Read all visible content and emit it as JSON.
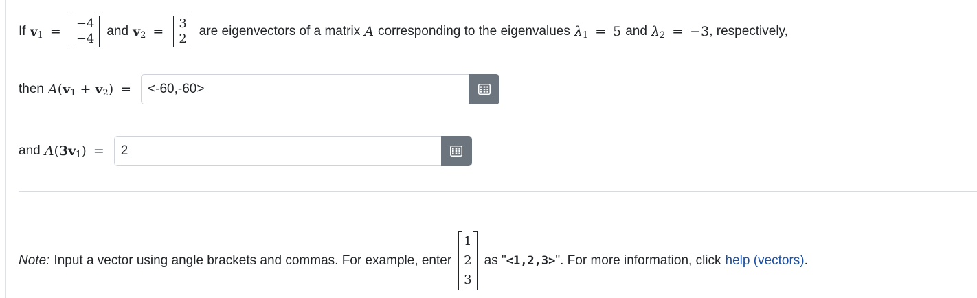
{
  "problem": {
    "if_text": "If",
    "v1_symbol": "v",
    "v1_sub": "1",
    "v1_entries": [
      "−4",
      "−4"
    ],
    "and_text_1": "and",
    "v2_symbol": "v",
    "v2_sub": "2",
    "v2_entries": [
      "3",
      "2"
    ],
    "mid_text": "are eigenvectors of a matrix",
    "matrix_symbol": "A",
    "corr_text": "corresponding to the eigenvalues",
    "lambda_symbol": "λ",
    "lambda1_sub": "1",
    "lambda1_value": "5",
    "and_text_2": "and",
    "lambda2_sub": "2",
    "lambda2_value": "−3",
    "end_text": ", respectively,"
  },
  "question1": {
    "lead_text": "then",
    "matrix_symbol": "A",
    "v_symbol": "v",
    "sub1": "1",
    "plus": "+",
    "sub2": "2",
    "answer_value": "<-60,-60>"
  },
  "question2": {
    "lead_text": "and",
    "matrix_symbol": "A",
    "coef": "3",
    "v_symbol": "v",
    "sub1": "1",
    "answer_value": "2"
  },
  "note": {
    "label": "Note:",
    "text_before": "Input a vector using angle brackets and commas. For example, enter",
    "example_entries": [
      "1",
      "2",
      "3"
    ],
    "text_as": "as \"",
    "example_code": "<1,2,3>",
    "text_after": "\". For more information, click",
    "link_text": "help (vectors)",
    "end": "."
  },
  "icons": {
    "keyboard_button": "keyboard-grid-icon"
  },
  "colors": {
    "button_bg": "#6c757d",
    "link": "#1a4fa0"
  }
}
